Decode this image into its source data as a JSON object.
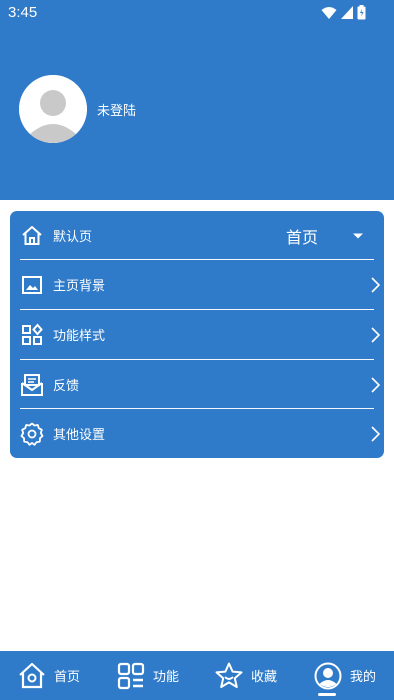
{
  "status": {
    "time": "3:45"
  },
  "profile": {
    "username": "未登陆"
  },
  "menu": {
    "items": [
      {
        "label": "默认页",
        "value": "首页"
      },
      {
        "label": "主页背景"
      },
      {
        "label": "功能样式"
      },
      {
        "label": "反馈"
      },
      {
        "label": "其他设置"
      }
    ]
  },
  "bottom_nav": {
    "items": [
      {
        "label": "首页"
      },
      {
        "label": "功能"
      },
      {
        "label": "收藏"
      },
      {
        "label": "我的"
      }
    ],
    "selected": "我的"
  },
  "colors": {
    "primary": "#2f7bc9",
    "background": "#ffffff",
    "text": "#ffffff"
  },
  "icons": [
    "home-icon",
    "image-icon",
    "grid-icon",
    "feedback-icon",
    "gear-icon",
    "star-icon",
    "user-icon",
    "wifi-icon",
    "signal-icon",
    "battery-icon",
    "chevron-right-icon",
    "caret-down-icon"
  ]
}
